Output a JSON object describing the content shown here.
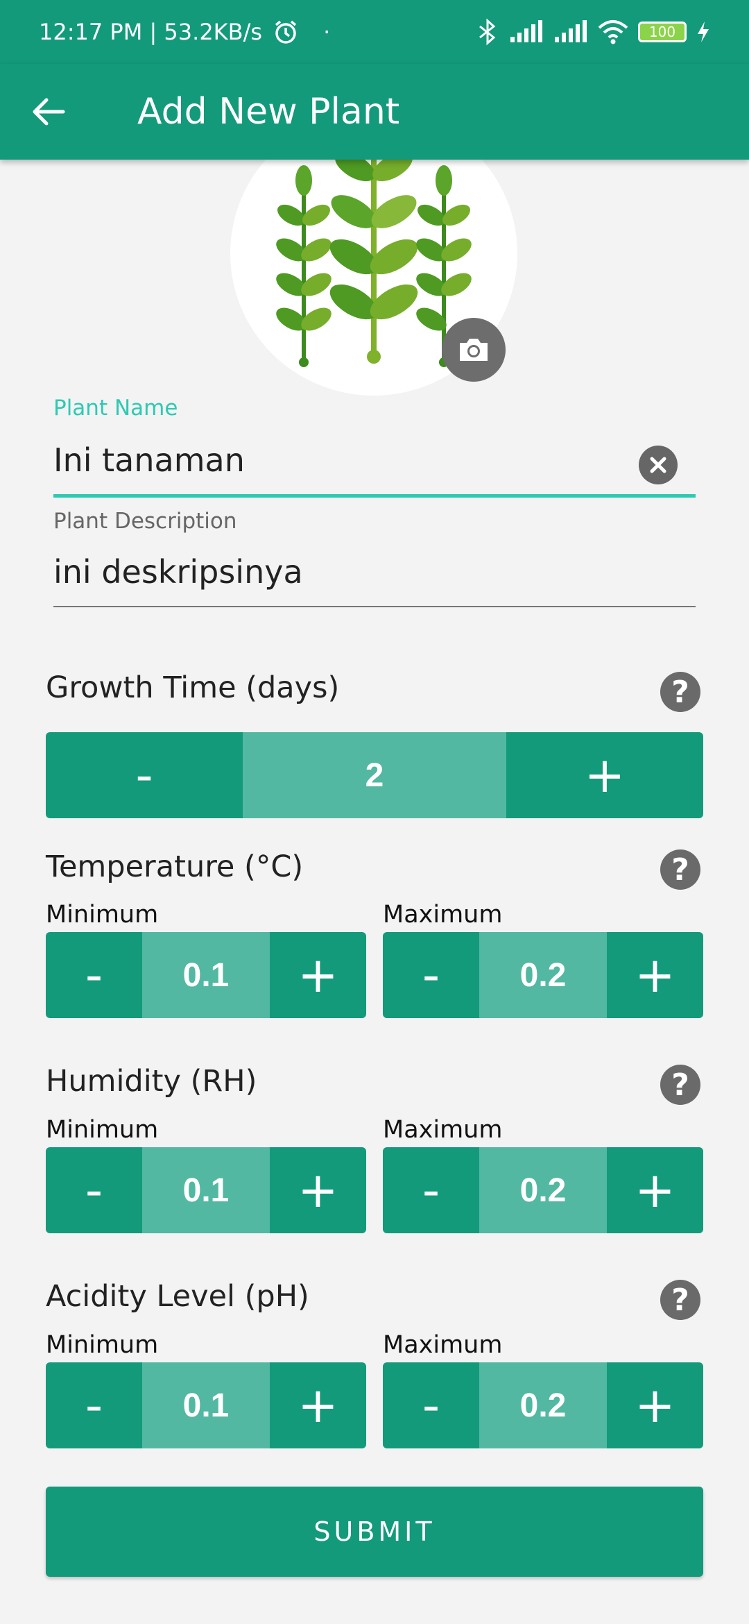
{
  "status_bar": {
    "time_speed": "12:17 PM | 53.2KB/s",
    "dot": "·",
    "battery": "100"
  },
  "app_bar": {
    "title": "Add New Plant"
  },
  "form": {
    "plant_name": {
      "label": "Plant Name",
      "value": "Ini tanaman"
    },
    "plant_description": {
      "label": "Plant Description",
      "value": "ini deskripsinya"
    }
  },
  "growth_time": {
    "title": "Growth Time (days)",
    "minus": "-",
    "value": "2",
    "plus": "+"
  },
  "temperature": {
    "title": "Temperature (°C)",
    "min_label": "Minimum",
    "max_label": "Maximum",
    "min": {
      "minus": "-",
      "value": "0.1",
      "plus": "+"
    },
    "max": {
      "minus": "-",
      "value": "0.2",
      "plus": "+"
    }
  },
  "humidity": {
    "title": "Humidity (RH)",
    "min_label": "Minimum",
    "max_label": "Maximum",
    "min": {
      "minus": "-",
      "value": "0.1",
      "plus": "+"
    },
    "max": {
      "minus": "-",
      "value": "0.2",
      "plus": "+"
    }
  },
  "acidity": {
    "title": "Acidity Level (pH)",
    "min_label": "Minimum",
    "max_label": "Maximum",
    "min": {
      "minus": "-",
      "value": "0.1",
      "plus": "+"
    },
    "max": {
      "minus": "-",
      "value": "0.2",
      "plus": "+"
    }
  },
  "help_icon_glyph": "?",
  "submit_label": "SUBMIT",
  "colors": {
    "primary": "#139a7b",
    "value_bg": "#52b8a2",
    "accent_field": "#2ec9b3",
    "background": "#f3f3f3"
  },
  "icons": [
    "back-arrow-icon",
    "camera-icon",
    "clear-icon",
    "help-icon",
    "alarm-icon",
    "bluetooth-icon",
    "signal-icon",
    "wifi-icon",
    "battery-icon",
    "charging-icon"
  ]
}
